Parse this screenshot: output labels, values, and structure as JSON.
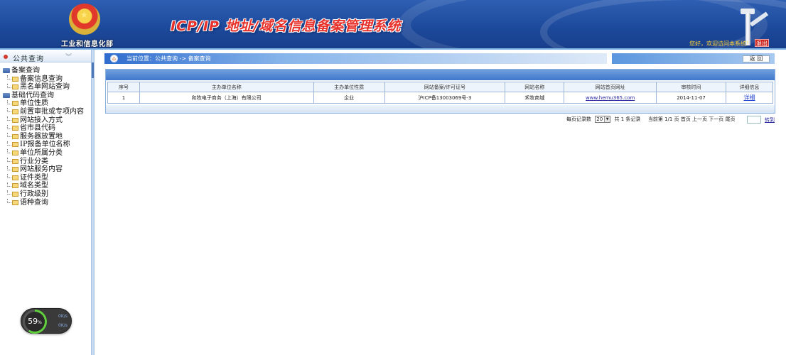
{
  "header": {
    "org_name": "工业和信息化部",
    "system_title": "ICP/IP 地址/域名信息备案管理系统",
    "welcome": "您好，欢迎访问本系统！",
    "logout": "退出"
  },
  "sidebar": {
    "section_title": "公共查询",
    "groups": [
      {
        "label": "备案查询",
        "items": [
          "备案信息查询",
          "黑名单网站查询"
        ]
      },
      {
        "label": "基础代码查询",
        "items": [
          "单位性质",
          "前置审批或专项内容",
          "网站接入方式",
          "省市县代码",
          "服务器放置地",
          "IP报备单位名称",
          "单位所属分类",
          "行业分类",
          "网站服务内容",
          "证件类型",
          "域名类型",
          "行政级别",
          "语种查询"
        ]
      }
    ]
  },
  "gauge": {
    "percent": "59",
    "percent_unit": "%",
    "up": "0K/s",
    "down": "0K/s"
  },
  "breadcrumb": {
    "text": "当前位置：公共查询  ->  备案查询"
  },
  "back_button": "返  回",
  "table": {
    "headers": [
      "序号",
      "主办单位名称",
      "主办单位性质",
      "网站备案/许可证号",
      "网站名称",
      "网站首页网址",
      "审核时间",
      "详细信息"
    ],
    "rows": [
      {
        "no": "1",
        "org": "和牧电子商务（上海）有限公司",
        "nature": "企业",
        "license": "沪ICP备13003069号-3",
        "site_name": "禾牧商城",
        "url": "www.hemu365.com",
        "date": "2014-11-07",
        "detail": "详细"
      }
    ]
  },
  "pager": {
    "per_page_label": "每页记录数",
    "per_page_value": "20",
    "total": "共 1 条记录",
    "current": "当前第 1/1 页",
    "first": "首页",
    "prev": "上一页",
    "next": "下一页",
    "last": "尾页",
    "jump": "转到"
  }
}
